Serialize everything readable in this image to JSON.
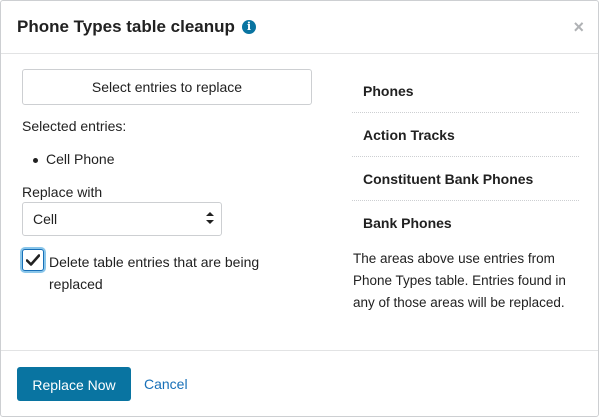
{
  "dialog": {
    "title": "Phone Types table cleanup",
    "info_icon": "info-icon",
    "close_icon": "close-icon"
  },
  "left": {
    "select_button_label": "Select entries to replace",
    "selected_label": "Selected entries:",
    "selected_entries": [
      "Cell Phone"
    ],
    "replace_with_label": "Replace with",
    "replace_with_value": "Cell",
    "delete_checkbox_checked": true,
    "delete_checkbox_label": "Delete table entries that are being replaced"
  },
  "right": {
    "areas": [
      "Phones",
      "Action Tracks",
      "Constituent Bank Phones",
      "Bank Phones"
    ],
    "note": "The areas above use entries from Phone Types table. Entries found in any of those areas will be replaced."
  },
  "footer": {
    "primary_label": "Replace Now",
    "cancel_label": "Cancel"
  },
  "colors": {
    "primary": "#0974a1",
    "link": "#1870b8",
    "border": "#cdcfd2"
  }
}
